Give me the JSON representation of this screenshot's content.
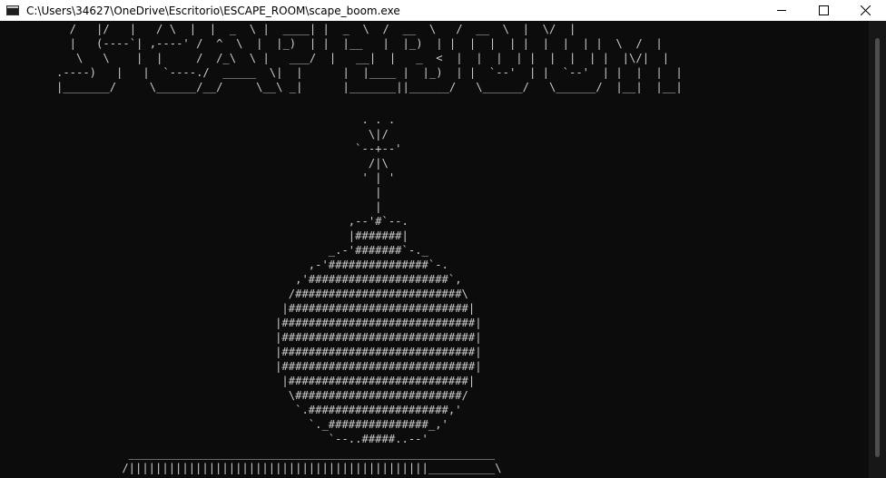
{
  "window": {
    "title": "C:\\Users\\34627\\OneDrive\\Escritorio\\ESCAPE_ROOM\\scape_boom.exe",
    "controls": {
      "minimize": "minimize-icon",
      "maximize": "maximize-icon",
      "close": "close-icon"
    }
  },
  "console": {
    "background": "#0c0c0c",
    "text_color": "#cccccc",
    "banner_lines": [
      "  /   |/   |   / \\  |  |  _  \\ |  ____| |  _  \\  /  __  \\   /  __  \\  |  \\/  |",
      "  |   (----`| ,----' /  ^  \\  |  |_)  | |  |__   |  |_)  | |  |  |  | |  |  |  | |  \\  /  |",
      "   \\   \\    |  |     /  /_\\  \\ |   ___/  |   __|  |   _  <  |  |  |  | |  |  |  | |  |\\/|  |",
      ".----)   |   |  `----./  _____  \\|  |      |  |____ |  |_)  | |  `--'  | |  `--'  | |  |  |  |",
      "|_______/     \\______/__/     \\__\\ _|      |_______||______/   \\______/   \\______/  |__|  |__|"
    ],
    "bomb_lines": [
      "                                     . . .",
      "                                      \\|/",
      "                                    `--+--'",
      "                                      /|\\",
      "                                     ' | '",
      "                                       |",
      "                                       |",
      "                                   ,--'#`--.",
      "                                   |#######|",
      "                                _.-'#######`-._",
      "                             ,-'###############`-.",
      "                           ,'#####################`,",
      "                          /#########################\\",
      "                         |###########################|",
      "                        |#############################|",
      "                        |#############################|",
      "                        |#############################|",
      "                        |#############################|",
      "                         |###########################|",
      "                          \\#########################/",
      "                           `.#####################,'",
      "                             `._###############_,'",
      "                                `--..#####..--'",
      "  _______________________________________________________",
      " /|||||||||||||||||||||||||||||||||||||||||||||__________\\"
    ]
  }
}
